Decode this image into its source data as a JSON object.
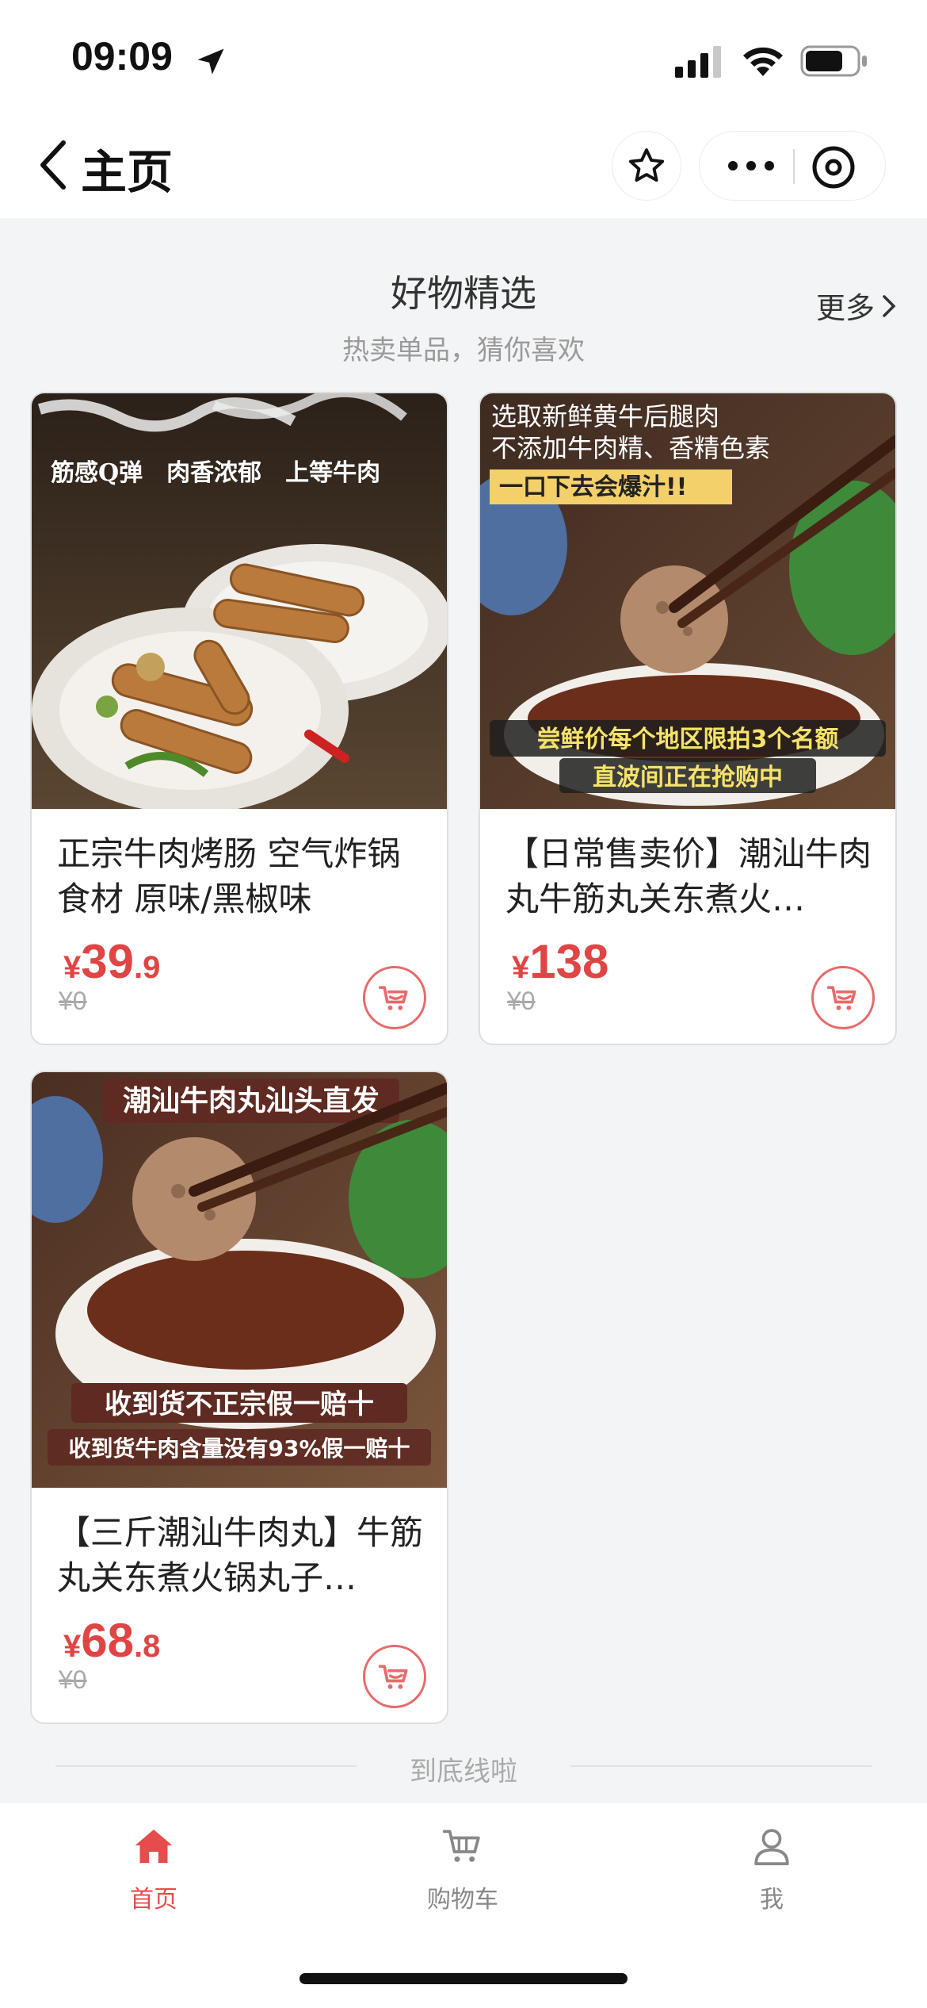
{
  "status_bar": {
    "time": "09:09"
  },
  "nav": {
    "back_label": "主页"
  },
  "section": {
    "title": "好物精选",
    "subtitle": "热卖单品，猜你喜欢",
    "more_label": "更多"
  },
  "products": [
    {
      "image_text_top": "筋感Q弹　肉香浓郁　上等牛肉",
      "title": "正宗牛肉烤肠 空气炸锅食材 原味/黑椒味",
      "currency": "¥",
      "price_int": "39",
      "price_dec": ".9",
      "original_price": "¥0"
    },
    {
      "image_text_top": "选取新鲜黄牛后腿肉",
      "image_text_2": "不添加牛肉精、香精色素",
      "image_text_3": "一口下去会爆汁!!",
      "image_text_4": "尝鲜价每个地区限拍3个名额",
      "image_text_5": "直波间正在抢购中",
      "title": "【日常售卖价】潮汕牛肉丸牛筋丸关东煮火…",
      "currency": "¥",
      "price_int": "138",
      "price_dec": "",
      "original_price": "¥0"
    },
    {
      "image_text_top": "潮汕牛肉丸汕头直发",
      "image_text_2": "收到货不正宗假一赔十",
      "image_text_3": "收到货牛肉含量没有93%假一赔十",
      "title": "【三斤潮汕牛肉丸】牛筋丸关东煮火锅丸子…",
      "currency": "¥",
      "price_int": "68",
      "price_dec": ".8",
      "original_price": "¥0"
    }
  ],
  "end_text": "到底线啦",
  "tabs": [
    {
      "label": "首页",
      "icon": "home-icon",
      "active": true
    },
    {
      "label": "购物车",
      "icon": "cart-icon",
      "active": false
    },
    {
      "label": "我",
      "icon": "user-icon",
      "active": false
    }
  ],
  "colors": {
    "accent": "#e84b4b",
    "price": "#e04545",
    "background": "#f3f4f6"
  }
}
